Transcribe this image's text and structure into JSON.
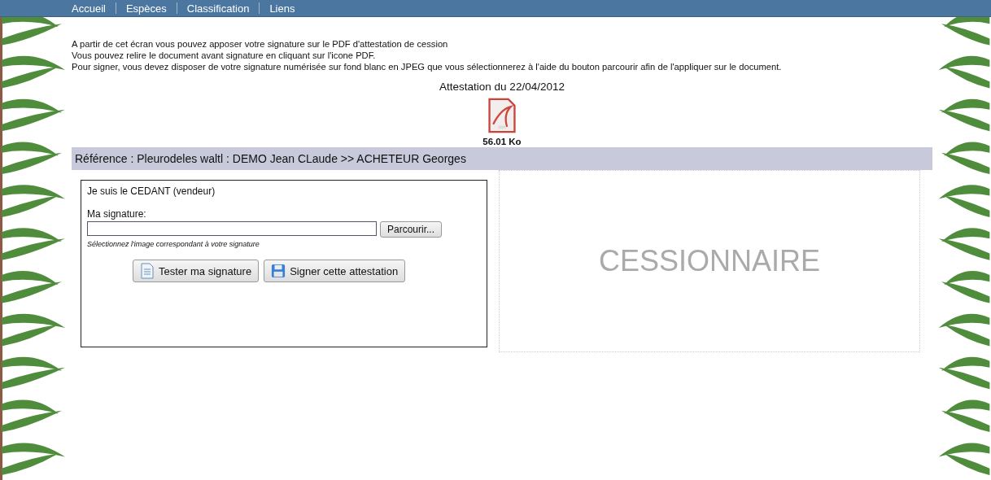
{
  "nav": {
    "items": [
      {
        "label": "Accueil"
      },
      {
        "label": "Espèces"
      },
      {
        "label": "Classification"
      },
      {
        "label": "Liens"
      }
    ]
  },
  "intro": [
    "A partir de cet écran vous pouvez apposer votre signature sur le PDF d'attestation de cession",
    "Vous pouvez relire le document avant signature en cliquant sur l'icone PDF.",
    "Pour signer, vous devez disposer de votre signature numérisée sur fond blanc en JPEG que vous sélectionnerez à l'aide du bouton parcourir afin de l'appliquer sur le document."
  ],
  "attestation": {
    "title": "Attestation du 22/04/2012",
    "size": "56.01 Ko"
  },
  "reference": "Référence : Pleurodeles waltl : DEMO Jean CLaude >> ACHETEUR Georges",
  "cedant": {
    "title": "Je suis le CEDANT (vendeur)",
    "field_label": "Ma signature:",
    "browse": "Parcourir...",
    "hint": "Sélectionnez l'image correspondant à votre signature",
    "buttons": [
      {
        "label": "Tester ma signature",
        "kind": "doc"
      },
      {
        "label": "Signer cette attestation",
        "kind": "save"
      }
    ]
  },
  "cessionnaire": {
    "label": "CESSIONNAIRE"
  }
}
